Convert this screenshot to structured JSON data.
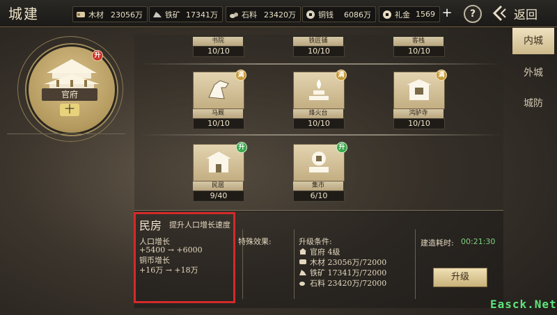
{
  "header": {
    "title": "城建",
    "resources": [
      {
        "icon": "wood-icon",
        "label": "木材",
        "value": "23056万"
      },
      {
        "icon": "iron-icon",
        "label": "铁矿",
        "value": "17341万"
      },
      {
        "icon": "stone-icon",
        "label": "石料",
        "value": "23420万"
      },
      {
        "icon": "copper-coin-icon",
        "label": "铜钱",
        "value": "6086万"
      },
      {
        "icon": "gift-money-icon",
        "label": "礼金",
        "value": "1569"
      }
    ],
    "plus": "+",
    "help": "?",
    "back_label": "返回"
  },
  "emblem": {
    "label": "官府",
    "badge": "升",
    "plus": "十"
  },
  "tabs": [
    "内城",
    "外城",
    "城防"
  ],
  "buildings_top": [
    {
      "name": "书院",
      "count": "10/10"
    },
    {
      "name": "铁匠铺",
      "count": "10/10"
    },
    {
      "name": "客栈",
      "count": "10/10"
    }
  ],
  "buildings_mid": [
    {
      "name": "马厩",
      "count": "10/10",
      "badge": "满",
      "icon": "horse-head-icon"
    },
    {
      "name": "烽火台",
      "count": "10/10",
      "badge": "满",
      "icon": "beacon-tower-icon"
    },
    {
      "name": "鸿胪寺",
      "count": "10/10",
      "badge": "满",
      "icon": "embassy-gate-icon"
    }
  ],
  "buildings_bottom": [
    {
      "name": "民居",
      "count": "9/40",
      "badge": "升",
      "icon": "residence-icon"
    },
    {
      "name": "集市",
      "count": "6/10",
      "badge": "升",
      "icon": "market-icon"
    }
  ],
  "detail": {
    "title": "民房",
    "subtitle": "提升人口增长速度",
    "pop_label": "人口增长",
    "pop_value": "+5400 → +6000",
    "coin_label": "铜币增长",
    "coin_value": "+16万 → +18万",
    "special_label": "特殊效果:",
    "req_label": "升级条件:",
    "requirements": [
      {
        "icon": "government-icon",
        "text": "官府 4级"
      },
      {
        "icon": "wood-icon",
        "text": "木材 23056万/72000"
      },
      {
        "icon": "iron-icon",
        "text": "铁矿 17341万/72000"
      },
      {
        "icon": "stone-icon",
        "text": "石料 23420万/72000"
      }
    ],
    "time_label": "建造耗时:",
    "time_value": "00:21:30",
    "upgrade_label": "升级"
  },
  "watermark": "Easck.Net",
  "colors": {
    "highlight": "#d42a2a",
    "time": "#7fd27f",
    "badge_green": "#3aa84c",
    "badge_gold": "#c89b3a"
  }
}
